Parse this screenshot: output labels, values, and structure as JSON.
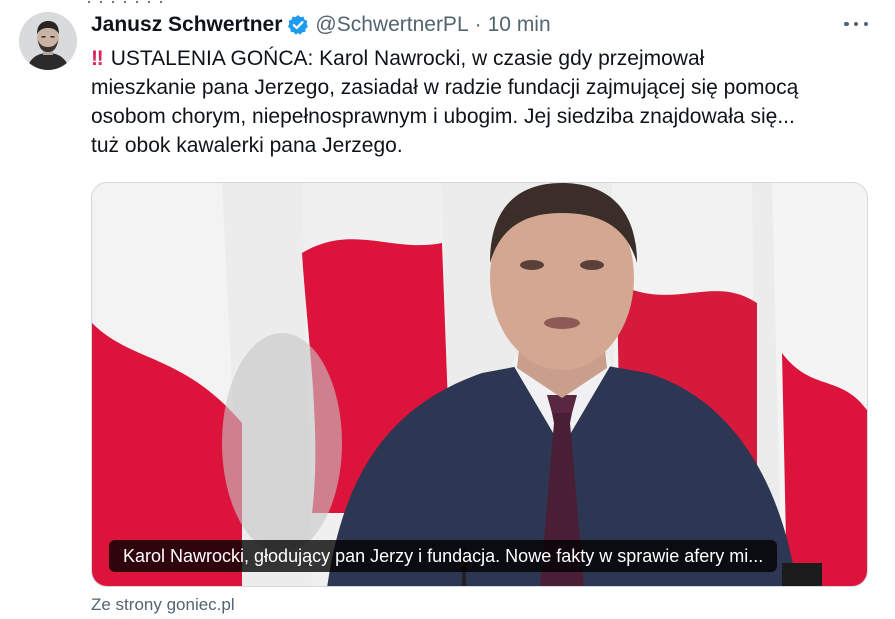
{
  "tweet": {
    "author_name": "Janusz Schwertner",
    "handle": "@SchwertnerPL",
    "separator": "·",
    "time": "10 min",
    "text_lines": [
      "USTALENIA GOŃCA: Karol Nawrocki, w czasie gdy przejmował",
      "mieszkanie pana Jerzego, zasiadał w radzie fundacji zajmującej się pomocą",
      "osobom chorym, niepełnosprawnym i ubogim. Jej siedziba znajdowała się...",
      "tuż obok kawalerki pana Jerzego."
    ],
    "prefix_glyph": "‼"
  },
  "media": {
    "caption": "Karol Nawrocki, głodujący pan Jerzy i fundacja. Nowe fakty w sprawie afery mi..."
  },
  "card": {
    "source": "Ze strony goniec.pl"
  },
  "icons": {
    "verified": "verified-badge-icon",
    "more": "more-options-icon"
  },
  "colors": {
    "verified_blue": "#1d9bf0",
    "secondary_text": "#536471",
    "flag_red": "#dc143c"
  }
}
